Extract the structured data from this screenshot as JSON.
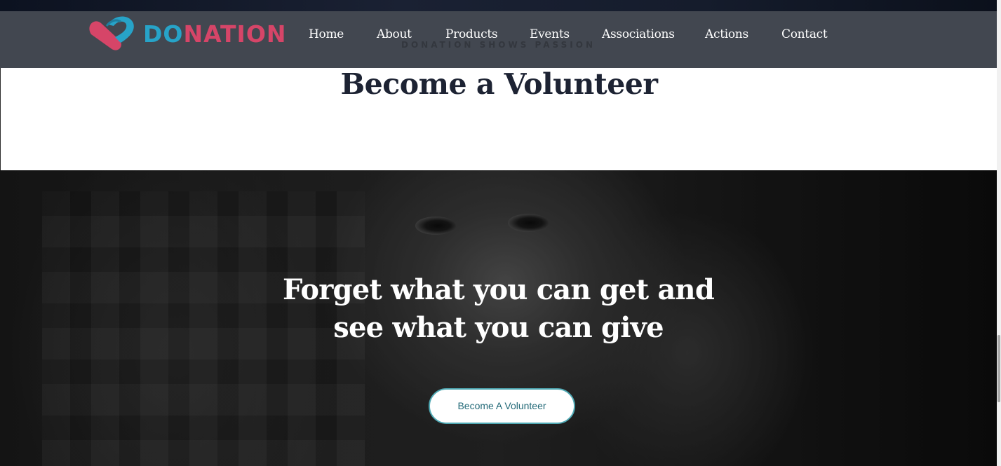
{
  "brand": {
    "logo_prefix": "DO",
    "logo_suffix": "NATION",
    "tagline": "DONATION SHOWS PASSION",
    "colors": {
      "logo_blue": "#27a3c8",
      "logo_pink": "#d64568"
    }
  },
  "nav": {
    "items": [
      {
        "label": "Home"
      },
      {
        "label": "About"
      },
      {
        "label": "Products"
      },
      {
        "label": "Events"
      },
      {
        "label": "Associations"
      },
      {
        "label": "Actions"
      },
      {
        "label": "Contact"
      }
    ]
  },
  "volunteer_section": {
    "title": "Become a Volunteer"
  },
  "hero": {
    "heading_line1": "Forget what you can get and",
    "heading_line2": "see what you can give",
    "cta_label": "Become A Volunteer"
  },
  "colors": {
    "navbar_bg": "#3a3f49",
    "title_text": "#1d2333",
    "cta_border": "#4fa9b4",
    "cta_text": "#236a78"
  }
}
